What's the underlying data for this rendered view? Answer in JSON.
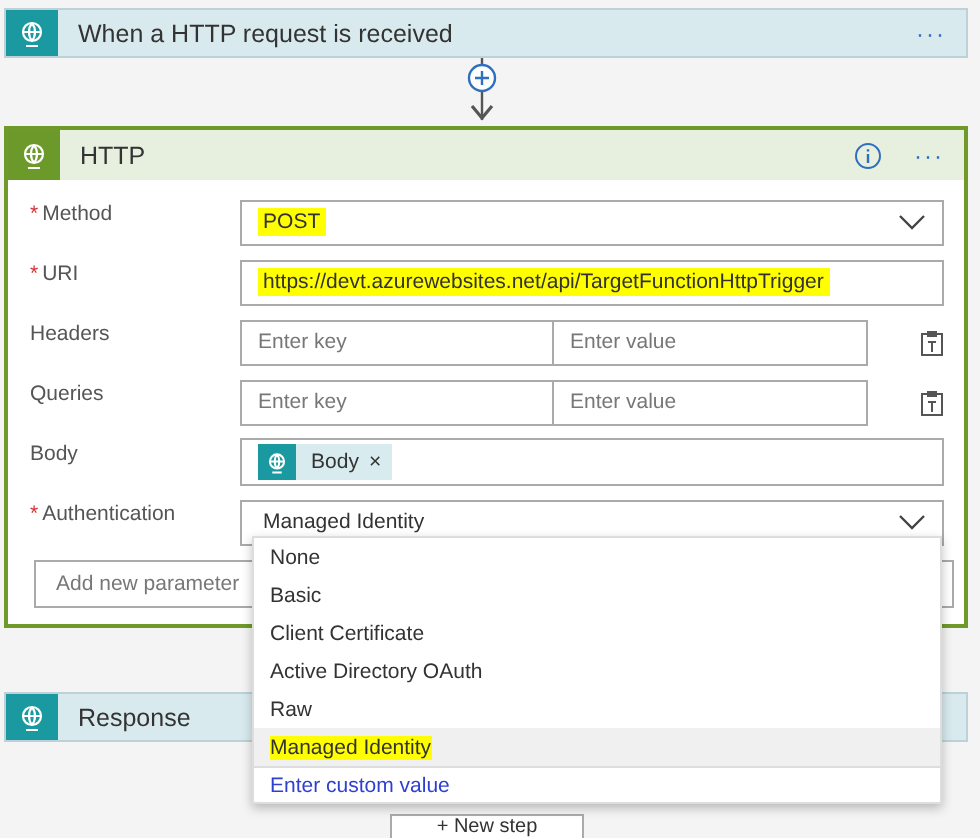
{
  "trigger": {
    "title": "When a HTTP request is received",
    "menu": "···"
  },
  "action": {
    "title": "HTTP",
    "menu": "···",
    "required_mark": "*",
    "fields": [
      {
        "kind": "select",
        "label": "Method",
        "required": true,
        "value": "POST",
        "highlighted": true
      },
      {
        "kind": "text",
        "label": "URI",
        "required": true,
        "value": "https://devt.azurewebsites.net/api/TargetFunctionHttpTrigger",
        "highlighted": true
      },
      {
        "kind": "keyvalue",
        "label": "Headers",
        "required": false,
        "key_placeholder": "Enter key",
        "value_placeholder": "Enter value"
      },
      {
        "kind": "keyvalue",
        "label": "Queries",
        "required": false,
        "key_placeholder": "Enter key",
        "value_placeholder": "Enter value"
      },
      {
        "kind": "tokens",
        "label": "Body",
        "required": false,
        "tokens": [
          {
            "label": "Body",
            "remove": "×"
          }
        ]
      },
      {
        "kind": "select",
        "label": "Authentication",
        "required": true,
        "value": "Managed Identity",
        "highlighted": false
      }
    ],
    "add_parameter": {
      "placeholder": "Add new parameter"
    }
  },
  "dropdown": {
    "options": [
      {
        "label": "None",
        "selected": false,
        "highlighted": false
      },
      {
        "label": "Basic",
        "selected": false,
        "highlighted": false
      },
      {
        "label": "Client Certificate",
        "selected": false,
        "highlighted": false
      },
      {
        "label": "Active Directory OAuth",
        "selected": false,
        "highlighted": false
      },
      {
        "label": "Raw",
        "selected": false,
        "highlighted": false
      },
      {
        "label": "Managed Identity",
        "selected": true,
        "highlighted": true
      }
    ],
    "custom": "Enter custom value"
  },
  "response": {
    "title": "Response"
  },
  "new_step": "+ New step"
}
